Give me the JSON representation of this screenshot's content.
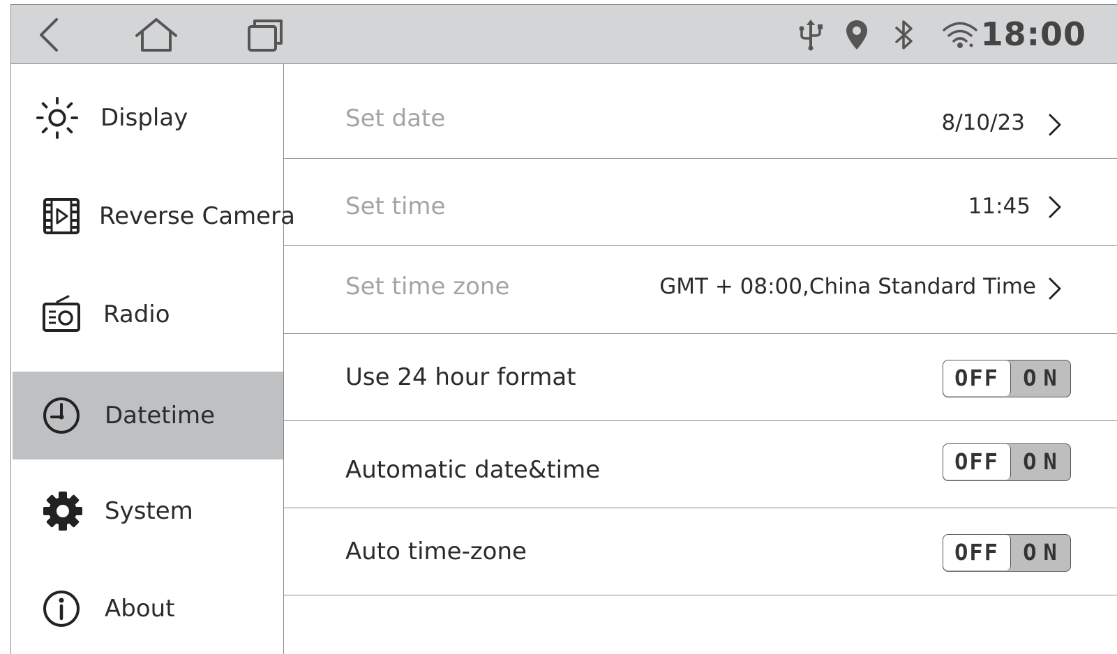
{
  "status_bar": {
    "nav_icons": [
      "back-icon",
      "home-icon",
      "recents-icon"
    ],
    "status_icons": [
      "usb-icon",
      "location-icon",
      "bluetooth-icon",
      "wifi-icon"
    ],
    "clock": "18:00"
  },
  "sidebar": {
    "items": [
      {
        "label": "Display",
        "icon": "brightness-icon",
        "active": false
      },
      {
        "label": "Reverse Camera",
        "icon": "video-film-icon",
        "active": false
      },
      {
        "label": "Radio",
        "icon": "radio-icon",
        "active": false
      },
      {
        "label": "Datetime",
        "icon": "clock-icon",
        "active": true
      },
      {
        "label": "System",
        "icon": "gear-icon",
        "active": false
      },
      {
        "label": "About",
        "icon": "info-icon",
        "active": false
      }
    ]
  },
  "settings": {
    "set_date": {
      "label": "Set date",
      "value": "8/10/23"
    },
    "set_time": {
      "label": "Set time",
      "value": "11:45"
    },
    "set_time_zone": {
      "label": "Set time zone",
      "value": "GMT + 08:00,China Standard Time"
    },
    "use_24h": {
      "label": "Use 24 hour format",
      "state": "OFF"
    },
    "auto_datetime": {
      "label": "Automatic date&time",
      "state": "OFF"
    },
    "auto_timezone": {
      "label": "Auto time-zone",
      "state": "OFF"
    },
    "toggle_off_text": "OFF",
    "toggle_on_text": "ON"
  },
  "colors": {
    "status_bar_bg": "#d4d5d7",
    "active_item_bg": "#bfc0c2",
    "disabled_text": "#a4a4a4",
    "divider": "#8a8a8a"
  }
}
